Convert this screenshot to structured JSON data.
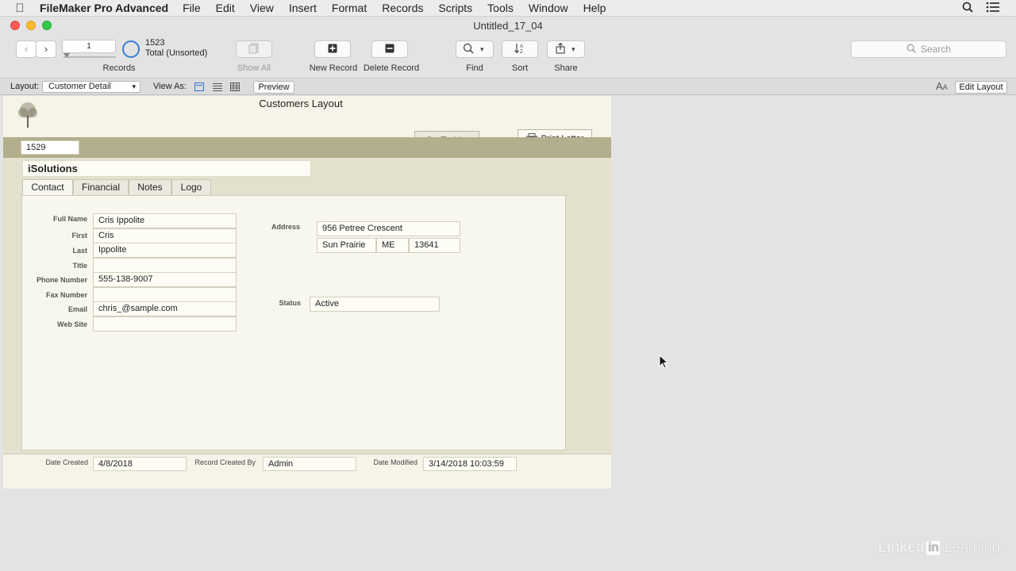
{
  "menubar": {
    "app_name": "FileMaker Pro Advanced",
    "menus": [
      "File",
      "Edit",
      "View",
      "Insert",
      "Format",
      "Records",
      "Scripts",
      "Tools",
      "Window",
      "Help"
    ]
  },
  "window": {
    "title": "Untitled_17_04"
  },
  "toolbar": {
    "record_current": "1",
    "record_total": "1523",
    "record_status": "Total (Unsorted)",
    "records_label": "Records",
    "show_all_label": "Show All",
    "new_record_label": "New Record",
    "delete_record_label": "Delete Record",
    "find_label": "Find",
    "sort_label": "Sort",
    "share_label": "Share",
    "search_placeholder": "Search"
  },
  "layoutbar": {
    "layout_label": "Layout:",
    "layout_value": "Customer Detail",
    "view_as_label": "View As:",
    "preview_label": "Preview",
    "edit_layout_label": "Edit Layout"
  },
  "layout": {
    "title": "Customers Layout",
    "go_to_list_label": "Go To List",
    "print_letter_label": "Print Letter",
    "customer_id": "1529",
    "company": "iSolutions",
    "tabs": [
      "Contact",
      "Financial",
      "Notes",
      "Logo"
    ],
    "active_tab": "Contact",
    "contact": {
      "full_name_label": "Full Name",
      "full_name": "Cris Ippolite",
      "first_label": "First",
      "first": "Cris",
      "last_label": "Last",
      "last": "Ippolite",
      "title_label": "Title",
      "title": "",
      "phone_label": "Phone Number",
      "phone": "555-138-9007",
      "fax_label": "Fax Number",
      "fax": "",
      "email_label": "Email",
      "email": "chris_@sample.com",
      "web_label": "Web Site",
      "web": "",
      "address_label": "Address",
      "street": "956 Petree Crescent",
      "city": "Sun Prairie",
      "state": "ME",
      "zip": "13641",
      "status_label": "Status",
      "status": "Active"
    },
    "footer": {
      "date_created_label": "Date Created",
      "date_created": "4/8/2018",
      "created_by_label": "Record Created By",
      "created_by": "Admin",
      "date_modified_label": "Date Modified",
      "date_modified": "3/14/2018 10:03:59"
    }
  },
  "watermark": {
    "brand_left": "Linked",
    "brand_in": "in",
    "brand_right": "Learning"
  }
}
